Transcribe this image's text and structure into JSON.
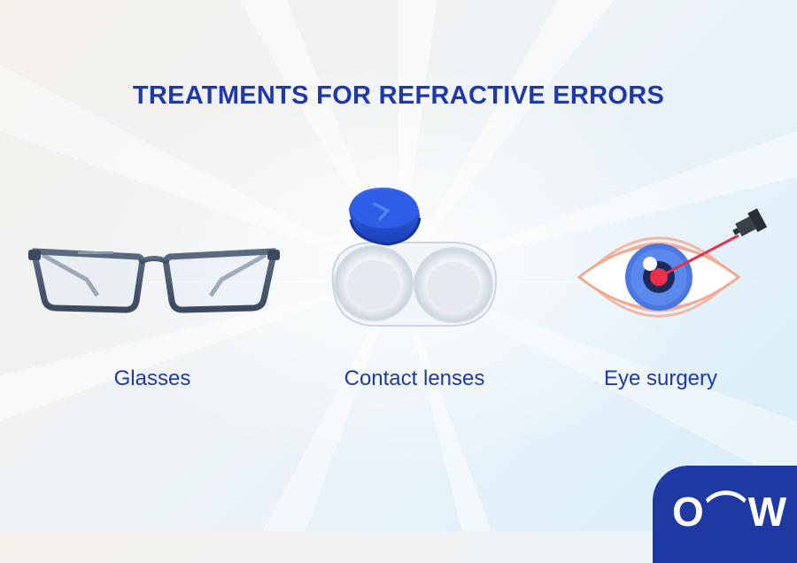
{
  "title": "TREATMENTS FOR REFRACTIVE ERRORS",
  "treatments": [
    {
      "label": "Glasses",
      "icon": "glasses-icon"
    },
    {
      "label": "Contact lenses",
      "icon": "contact-lens-case-icon"
    },
    {
      "label": "Eye surgery",
      "icon": "laser-eye-icon"
    }
  ],
  "logo": {
    "text": "O⌒W"
  },
  "colors": {
    "accent": "#1f3aa8",
    "logo_bg": "#1e3aa2",
    "lens_cap": "#1f4fd6",
    "iris": "#4a78e0",
    "laser": "#e8304a"
  }
}
